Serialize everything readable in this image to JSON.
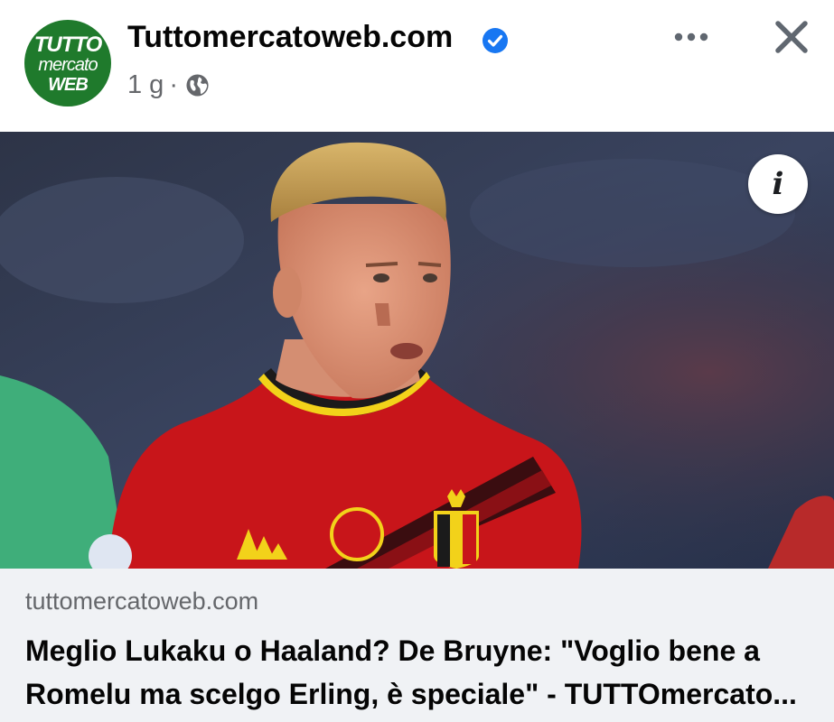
{
  "post": {
    "page_name": "Tuttomercatoweb.com",
    "time": "1 g",
    "separator": "·",
    "privacy_icon": "globe-icon",
    "verified_icon": "verified-badge-icon",
    "more_icon": "more-options-icon",
    "close_icon": "close-icon",
    "logo": {
      "line1": "TUTTO",
      "line2": "mercato",
      "line3": "WEB"
    }
  },
  "link": {
    "info_icon": "info-icon",
    "info_glyph": "i",
    "domain": "tuttomercatoweb.com",
    "headline": "Meglio Lukaku o Haaland? De Bruyne: \"Voglio bene a Romelu ma scelgo Erling, è speciale\" - TUTTOmercato..."
  },
  "colors": {
    "verified": "#1877f2",
    "logo_green": "#1f7a2c",
    "jersey_red": "#c8151a",
    "caption_bg": "#f0f2f5"
  }
}
